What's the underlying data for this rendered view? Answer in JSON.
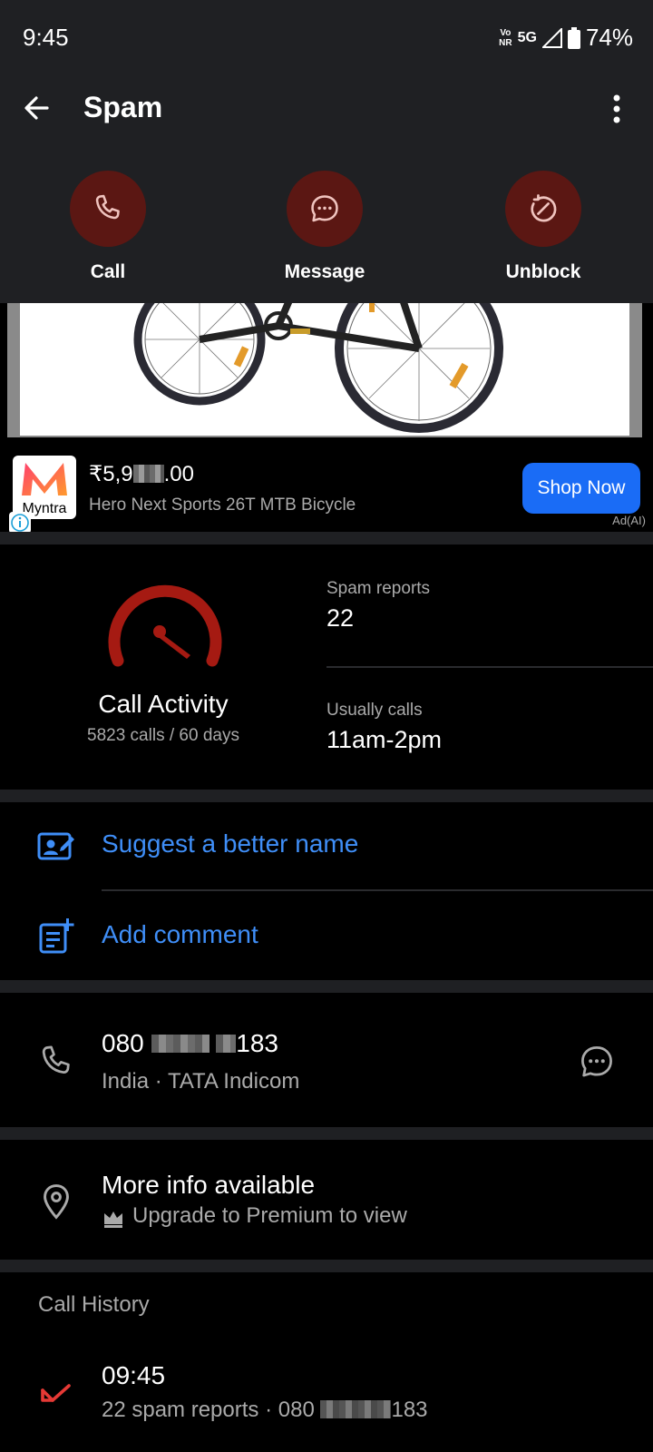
{
  "status_bar": {
    "time": "9:45",
    "volte_top": "Vo",
    "volte_bottom": "NR",
    "network": "5G",
    "battery": "74%"
  },
  "header": {
    "title": "Spam",
    "back_icon": "arrow-left-icon",
    "menu_icon": "more-vert-icon"
  },
  "actions": [
    {
      "label": "Call",
      "icon": "phone-icon"
    },
    {
      "label": "Message",
      "icon": "chat-bubble-icon"
    },
    {
      "label": "Unblock",
      "icon": "unblock-icon"
    }
  ],
  "ad": {
    "brand": "Myntra",
    "price_prefix": "₹5,9",
    "price_suffix": ".00",
    "product": "Hero Next Sports 26T MTB Bicycle",
    "cta": "Shop Now",
    "tag": "Ad(AI)"
  },
  "activity": {
    "title": "Call Activity",
    "subtitle": "5823 calls / 60 days",
    "spam_reports_label": "Spam reports",
    "spam_reports_value": "22",
    "usually_calls_label": "Usually calls",
    "usually_calls_value": "11am-2pm"
  },
  "links": {
    "suggest_name": "Suggest a better name",
    "add_comment": "Add comment"
  },
  "number_info": {
    "number_prefix": "080",
    "number_suffix": "183",
    "carrier": "India · TATA Indicom"
  },
  "more_info": {
    "title": "More info available",
    "subtitle": "Upgrade to Premium to view"
  },
  "call_history": {
    "heading": "Call History",
    "items": [
      {
        "time": "09:45",
        "detail_prefix": "22 spam reports · 080",
        "detail_suffix": "183"
      }
    ]
  },
  "colors": {
    "accent_red": "#a51a12",
    "link_blue": "#3f8ef7",
    "cta_blue": "#1a6cf6"
  }
}
